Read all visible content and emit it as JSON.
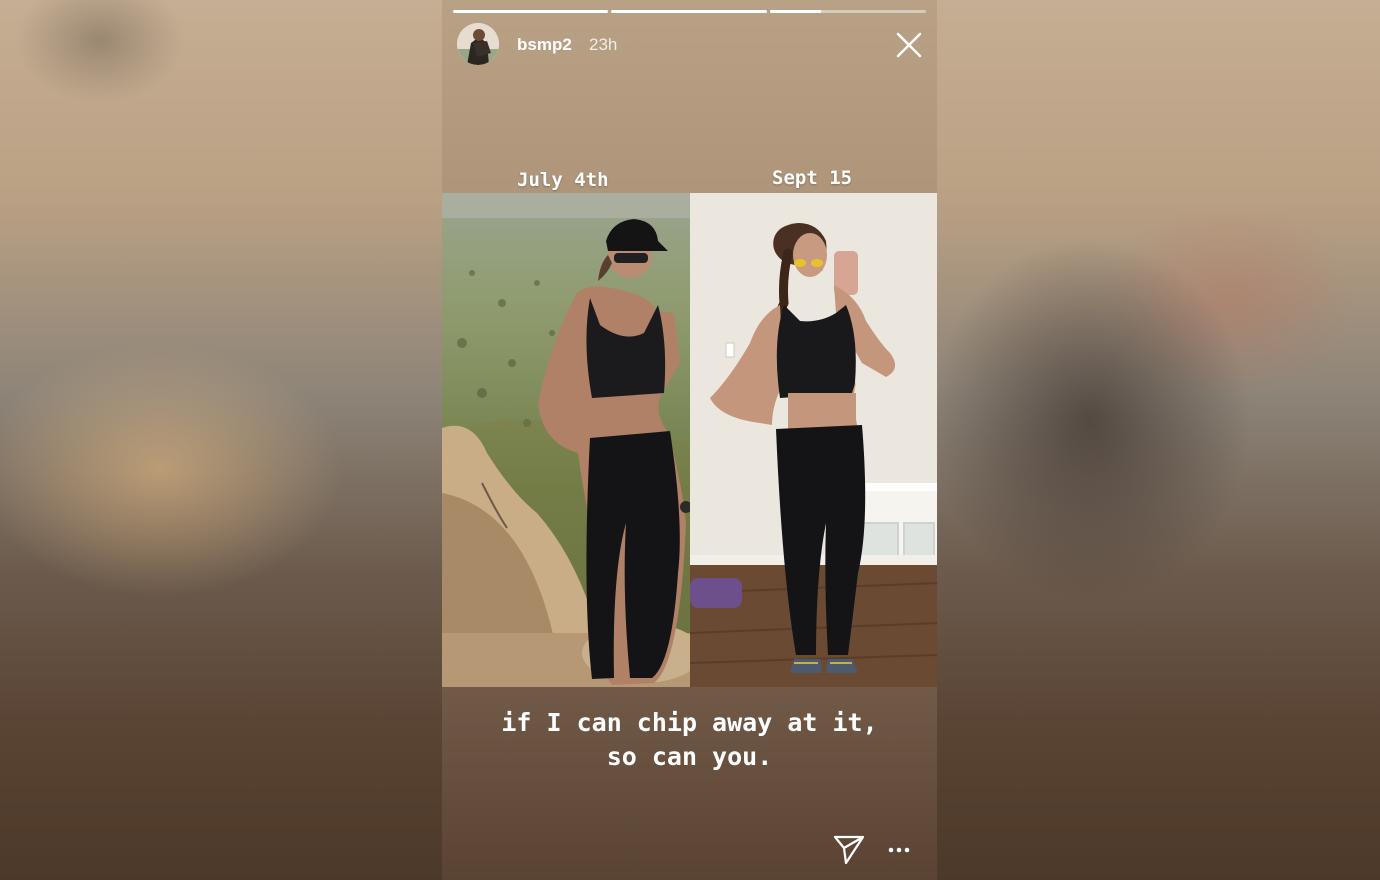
{
  "story": {
    "username": "bsmp2",
    "time_ago": "23h",
    "progress_segments": [
      1.0,
      1.0,
      0.33
    ],
    "photos": [
      {
        "label": "July 4th",
        "setting": "desert hilltop overlook"
      },
      {
        "label": "Sept 15",
        "setting": "indoor mirror selfie"
      }
    ],
    "caption_lines": [
      "if I can chip away at it,",
      "so can you."
    ]
  },
  "icons": {
    "close": "close-icon",
    "send": "paper-plane-icon",
    "more": "more-horizontal-icon"
  },
  "colors": {
    "overlay_text": "#ffffff",
    "progress_track": "rgba(255,255,255,0.45)"
  }
}
